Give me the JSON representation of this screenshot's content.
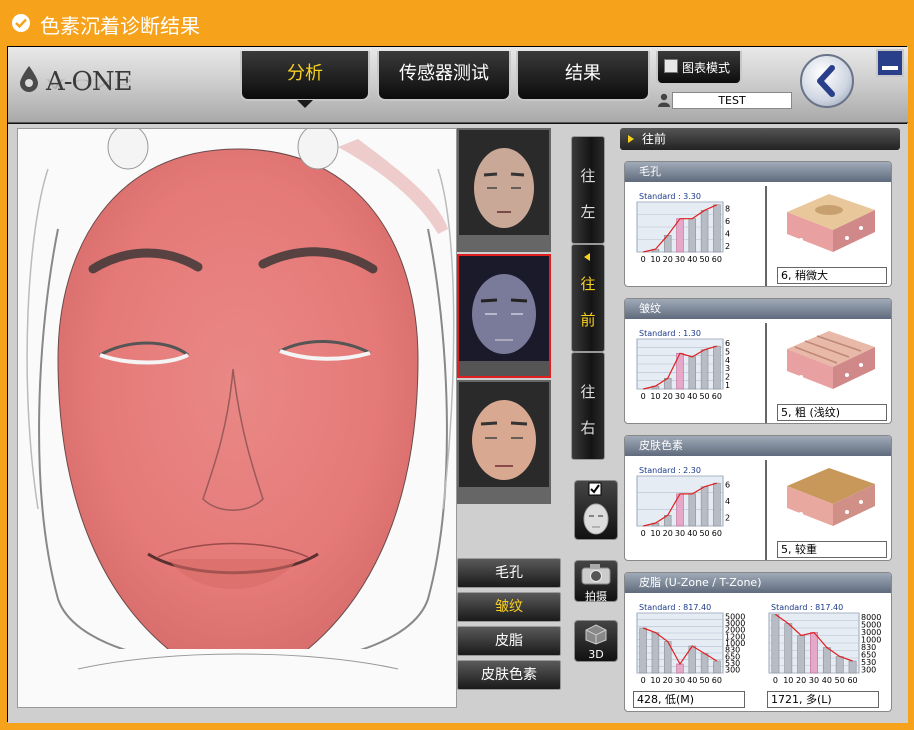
{
  "window": {
    "title": "色素沉着诊断结果"
  },
  "header": {
    "logo_text": "A-ONE",
    "tabs": [
      {
        "label": "分析",
        "active": true
      },
      {
        "label": "传感器测试",
        "active": false
      },
      {
        "label": "结果",
        "active": false
      }
    ],
    "chart_mode_label": "图表模式",
    "user": "TEST"
  },
  "direction_buttons": [
    {
      "l1": "往",
      "l2": "左",
      "active": false
    },
    {
      "l1": "往",
      "l2": "前",
      "active": true
    },
    {
      "l1": "往",
      "l2": "右",
      "active": false
    }
  ],
  "mode_buttons": [
    {
      "label": "毛孔",
      "active": false
    },
    {
      "label": "皱纹",
      "active": true
    },
    {
      "label": "皮脂",
      "active": false
    },
    {
      "label": "皮肤色素",
      "active": false
    }
  ],
  "icon_buttons": {
    "capture": "拍摄",
    "threeD": "3D"
  },
  "panel": {
    "header": "往前"
  },
  "accent": "#f7d020",
  "chart_data": [
    {
      "title": "毛孔",
      "type": "bar+line",
      "standard": "Standard : 3.30",
      "categories": [
        "0",
        "10",
        "20",
        "30",
        "40",
        "50",
        "60"
      ],
      "values": [
        0,
        0.5,
        3,
        6,
        6,
        7.5,
        8.5
      ],
      "highlight_index": 3,
      "yticks": [
        "8",
        "6",
        "4",
        "2"
      ],
      "ylim": [
        0,
        9
      ],
      "result": "6, 稍微大"
    },
    {
      "title": "皱纹",
      "type": "bar+line",
      "standard": "Standard : 1.30",
      "categories": [
        "0",
        "10",
        "20",
        "30",
        "40",
        "50",
        "60"
      ],
      "values": [
        0,
        0.4,
        1.5,
        5,
        4.5,
        5.5,
        6
      ],
      "highlight_index": 3,
      "yticks": [
        "6",
        "5",
        "4",
        "3",
        "2",
        "1"
      ],
      "ylim": [
        0,
        7
      ],
      "result": "5, 粗 (浅纹)"
    },
    {
      "title": "皮肤色素",
      "type": "bar+line",
      "standard": "Standard : 2.30",
      "categories": [
        "0",
        "10",
        "20",
        "30",
        "40",
        "50",
        "60"
      ],
      "values": [
        0,
        0.4,
        1.5,
        4.5,
        4.5,
        5.5,
        6
      ],
      "highlight_index": 3,
      "yticks": [
        "6",
        "4",
        "2"
      ],
      "ylim": [
        0,
        7
      ],
      "result": "5, 较重"
    },
    {
      "title": "皮脂 (U-Zone / T-Zone)",
      "type": "bar+line",
      "standard": "Standard : 817.40",
      "charts": [
        {
          "categories": [
            "0",
            "10",
            "20",
            "30",
            "40",
            "50",
            "60"
          ],
          "values": [
            6,
            5.4,
            4.2,
            1.2,
            3.6,
            2.6,
            1.6
          ],
          "highlight_index": 3,
          "yticks": [
            "5000",
            "3000",
            "2000",
            "1200",
            "1000",
            "830",
            "650",
            "530",
            "300"
          ],
          "ylim": [
            0,
            8
          ],
          "result": "428, 低(M)"
        },
        {
          "categories": [
            "0",
            "10",
            "20",
            "30",
            "40",
            "50",
            "60"
          ],
          "values": [
            7.8,
            6.6,
            5,
            5.4,
            3.4,
            2.2,
            1.6
          ],
          "highlight_index": 3,
          "yticks": [
            "8000",
            "5000",
            "3000",
            "1000",
            "830",
            "650",
            "530",
            "300"
          ],
          "ylim": [
            0,
            8
          ],
          "result": "1721, 多(L)"
        }
      ]
    }
  ]
}
